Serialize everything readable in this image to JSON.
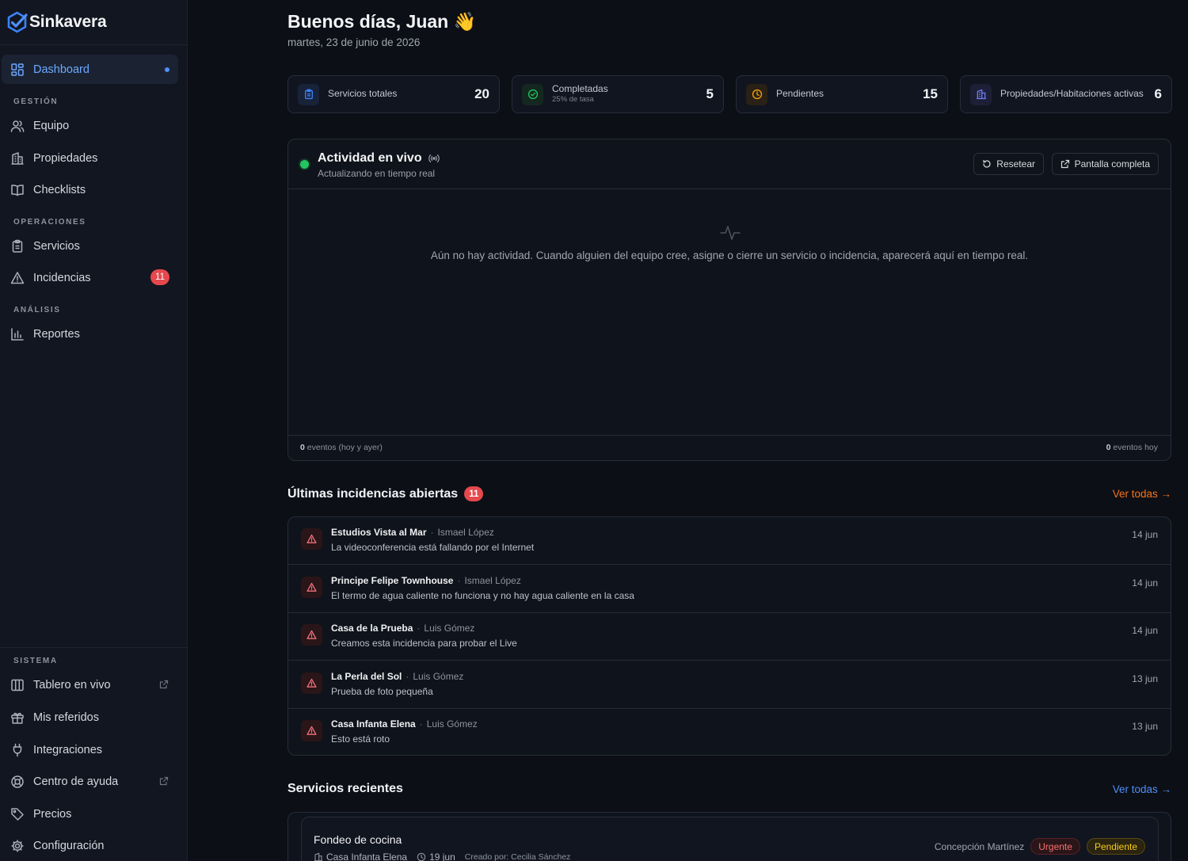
{
  "brand": {
    "name": "Sinkavera",
    "accent": "#4f8ff7"
  },
  "sidebar": {
    "dashboard": {
      "label": "Dashboard",
      "icon": "grid-icon",
      "active": true
    },
    "sections": {
      "gestion": "GESTIÓN",
      "operaciones": "OPERACIONES",
      "analisis": "ANÁLISIS",
      "sistema": "SISTEMA"
    },
    "gestion_items": [
      {
        "label": "Equipo",
        "icon": "users-icon"
      },
      {
        "label": "Propiedades",
        "icon": "building-icon"
      },
      {
        "label": "Checklists",
        "icon": "book-icon"
      }
    ],
    "operaciones_items": [
      {
        "label": "Servicios",
        "icon": "clipboard-icon"
      },
      {
        "label": "Incidencias",
        "icon": "warning-icon",
        "badge": "11"
      }
    ],
    "analisis_items": [
      {
        "label": "Reportes",
        "icon": "bar-chart-icon"
      }
    ],
    "sistema_items": [
      {
        "label": "Tablero en vivo",
        "icon": "columns-icon",
        "external": true
      },
      {
        "label": "Mis referidos",
        "icon": "gift-icon"
      },
      {
        "label": "Integraciones",
        "icon": "plug-icon"
      },
      {
        "label": "Centro de ayuda",
        "icon": "lifebuoy-icon",
        "external": true
      },
      {
        "label": "Precios",
        "icon": "tag-icon"
      },
      {
        "label": "Configuración",
        "icon": "gear-icon"
      }
    ]
  },
  "header": {
    "greeting": "Buenos días, Juan 👋",
    "date": "martes, 23 de junio de 2026"
  },
  "stats": [
    {
      "label": "Servicios totales",
      "sub": "",
      "value": "20",
      "icon": "clipboard-icon",
      "color": "#3b82f6"
    },
    {
      "label": "Completadas",
      "sub": "25% de tasa",
      "value": "5",
      "icon": "check-circle-icon",
      "color": "#22c55e"
    },
    {
      "label": "Pendientes",
      "sub": "",
      "value": "15",
      "icon": "clock-icon",
      "color": "#f59e0b"
    },
    {
      "label": "Propiedades/Habitaciones activas",
      "sub": "",
      "value": "6",
      "icon": "building-icon",
      "color": "#6366f1"
    }
  ],
  "live": {
    "title": "Actividad en vivo",
    "subtitle": "Actualizando en tiempo real",
    "reset_label": "Resetear",
    "fullscreen_label": "Pantalla completa",
    "empty_text": "Aún no hay actividad. Cuando alguien del equipo cree, asigne o cierre un servicio o incidencia, aparecerá aquí en tiempo real.",
    "footer_left_count": "0",
    "footer_left_text": "eventos (hoy y ayer)",
    "footer_right_count": "0",
    "footer_right_text": "eventos hoy",
    "status_color": "#22c55e"
  },
  "incidents": {
    "title": "Últimas incidencias abiertas",
    "count": "11",
    "view_all": "Ver todas →",
    "view_all_color": "#f97316",
    "items": [
      {
        "property": "Estudios Vista al Mar",
        "user": "Ismael López",
        "description": "La videoconferencia está fallando por el Internet",
        "date": "14 jun"
      },
      {
        "property": "Principe Felipe Townhouse",
        "user": "Ismael López",
        "description": "El termo de agua caliente no funciona y no hay agua caliente en la casa",
        "date": "14 jun"
      },
      {
        "property": "Casa de la Prueba",
        "user": "Luis Gómez",
        "description": "Creamos esta incidencia para probar el Live",
        "date": "14 jun"
      },
      {
        "property": "La Perla del Sol",
        "user": "Luis Gómez",
        "description": "Prueba de foto pequeña",
        "date": "13 jun"
      },
      {
        "property": "Casa Infanta Elena",
        "user": "Luis Gómez",
        "description": "Esto está roto",
        "date": "13 jun"
      }
    ]
  },
  "services": {
    "title": "Servicios recientes",
    "view_all": "Ver todas →",
    "view_all_color": "#4f8ff7",
    "items": [
      {
        "title": "Fondeo de cocina",
        "property": "Casa Infanta Elena",
        "date": "19 jun",
        "created_by": "Creado por: Cecilia Sánchez",
        "assignee": "Concepción Martínez",
        "priority": "Urgente",
        "priority_color": "#ef4444",
        "status": "Pendiente",
        "status_color": "#eab308"
      }
    ]
  }
}
